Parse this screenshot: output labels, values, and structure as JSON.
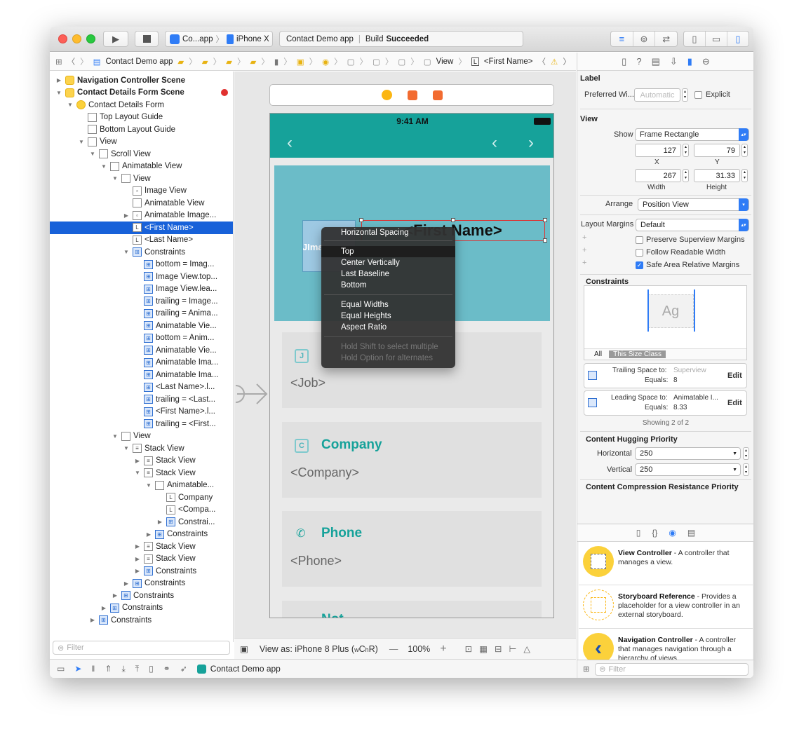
{
  "toolbar": {
    "scheme_app": "Co...app",
    "scheme_device": "iPhone X",
    "activity_project": "Contact Demo app",
    "activity_build": "Build",
    "activity_status": "Succeeded"
  },
  "jumpbar": {
    "project": "Contact Demo app",
    "crumb_view": "View",
    "crumb_label": "<First Name>"
  },
  "navigator": {
    "rows": [
      "Navigation Controller Scene",
      "Contact Details Form Scene",
      "Contact Details Form",
      "Top Layout Guide",
      "Bottom Layout Guide",
      "View",
      "Scroll View",
      "Animatable View",
      "View",
      "Image View",
      "Animatable View",
      "Animatable Image...",
      "<First Name>",
      "<Last Name>",
      "Constraints",
      "bottom = Imag...",
      "Image View.top...",
      "Image View.lea...",
      "trailing = Image...",
      "trailing = Anima...",
      "Animatable Vie...",
      "bottom = Anim...",
      "Animatable Vie...",
      "Animatable Ima...",
      "Animatable Ima...",
      "<Last Name>.l...",
      "trailing = <Last...",
      "<First Name>.l...",
      "trailing = <First...",
      "View",
      "Stack View",
      "Stack View",
      "Stack View",
      "Animatable...",
      "Company",
      "<Compa...",
      "Constrai...",
      "Constraints",
      "Stack View",
      "Stack View",
      "Constraints",
      "Constraints",
      "Constraints",
      "Constraints",
      "Constraints"
    ],
    "filter_placeholder": "Filter"
  },
  "bottom": {
    "target": "Contact Demo app"
  },
  "canvas": {
    "status_time": "9:41 AM",
    "header_name": "<First Name>",
    "header_image_text": "JIma",
    "cards": [
      {
        "icon": "J",
        "title": "",
        "value": "<Job>"
      },
      {
        "icon": "C",
        "title": "Company",
        "value": "<Company>"
      },
      {
        "icon": "✆",
        "title": "Phone",
        "value": "<Phone>"
      },
      {
        "icon": "",
        "title": "Not",
        "value": ""
      }
    ],
    "view_as_prefix": "View as: iPhone 8 Plus (",
    "view_as_wc": "w",
    "view_as_c1": "C ",
    "view_as_hr": "h",
    "view_as_r": "R)",
    "zoom": "100%",
    "zoom_minus": "—",
    "zoom_plus": "+"
  },
  "menu": {
    "items": [
      "Horizontal Spacing",
      "Top",
      "Center Vertically",
      "Last Baseline",
      "Bottom",
      "Equal Widths",
      "Equal Heights",
      "Aspect Ratio",
      "Hold Shift to select multiple",
      "Hold Option for alternates"
    ]
  },
  "inspector": {
    "label_section": "Label",
    "preferred_width_label": "Preferred Wi...",
    "preferred_width_placeholder": "Automatic",
    "explicit_label": "Explicit",
    "view_section": "View",
    "show_label": "Show",
    "show_value": "Frame Rectangle",
    "x": "127",
    "y": "79",
    "width": "267",
    "height": "31.33",
    "x_label": "X",
    "y_label": "Y",
    "width_label": "Width",
    "height_label": "Height",
    "arrange_label": "Arrange",
    "arrange_value": "Position View",
    "layout_margins_label": "Layout Margins",
    "layout_margins_value": "Default",
    "preserve_margins": "Preserve Superview Margins",
    "follow_readable": "Follow Readable Width",
    "safe_area": "Safe Area Relative Margins",
    "constraints_section": "Constraints",
    "ag": "Ag",
    "all": "All",
    "this_size_class": "This Size Class",
    "constraint1_label": "Trailing Space to:",
    "constraint1_target": "Superview",
    "constraint1_equals_label": "Equals:",
    "constraint1_equals": "8",
    "constraint2_label": "Leading Space to:",
    "constraint2_target": "Animatable I...",
    "constraint2_equals_label": "Equals:",
    "constraint2_equals": "8.33",
    "edit": "Edit",
    "showing": "Showing 2 of 2",
    "hugging_section": "Content Hugging Priority",
    "horizontal_label": "Horizontal",
    "horizontal_value": "250",
    "vertical_label": "Vertical",
    "vertical_value": "250",
    "compression_section": "Content Compression Resistance Priority"
  },
  "library": {
    "items": [
      {
        "title": "View Controller",
        "desc": " - A controller that manages a view."
      },
      {
        "title": "Storyboard Reference",
        "desc": " - Provides a placeholder for a view controller in an external storyboard."
      },
      {
        "title": "Navigation Controller",
        "desc": " - A controller that manages navigation through a hierarchy of views."
      }
    ],
    "filter_placeholder": "Filter"
  },
  "colors": {
    "accent": "#16a29a",
    "selection": "#1761d9",
    "header": "#6bbcc8"
  }
}
